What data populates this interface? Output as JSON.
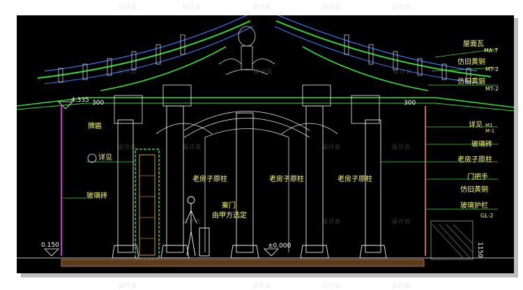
{
  "watermark": "设计云",
  "dims": {
    "eave_height": "4.335",
    "eave_left_300": "300",
    "eave_right_300": "300",
    "base_left": "0.150",
    "floor_level": "±0.000",
    "side_height": "1150"
  },
  "labels": {
    "roof_tile": "屋面瓦",
    "roof_tile_code": "MA-7",
    "copper_1": "仿旧黄铜",
    "copper_1_code": "MT-2",
    "copper_2": "仿旧黄铜",
    "copper_2_code": "MT-2",
    "plaque": "牌匾",
    "detail_left": "详见",
    "glass_brick": "玻璃砖",
    "column_1": "老房子原柱",
    "column_2": "老房子原柱",
    "column_3": "老房子原柱",
    "door": "案门",
    "by_owner": "由甲方选定",
    "detail_right": "详见",
    "detail_right_code_a": "M1",
    "detail_right_code_b": "M-1",
    "glass_brick_right": "玻璃砖",
    "column_right": "老房子原柱",
    "door_handle": "门把手",
    "copper_3": "仿旧黄铜",
    "glass_rail": "玻璃护栏",
    "copper_3_code": "GL-2"
  }
}
